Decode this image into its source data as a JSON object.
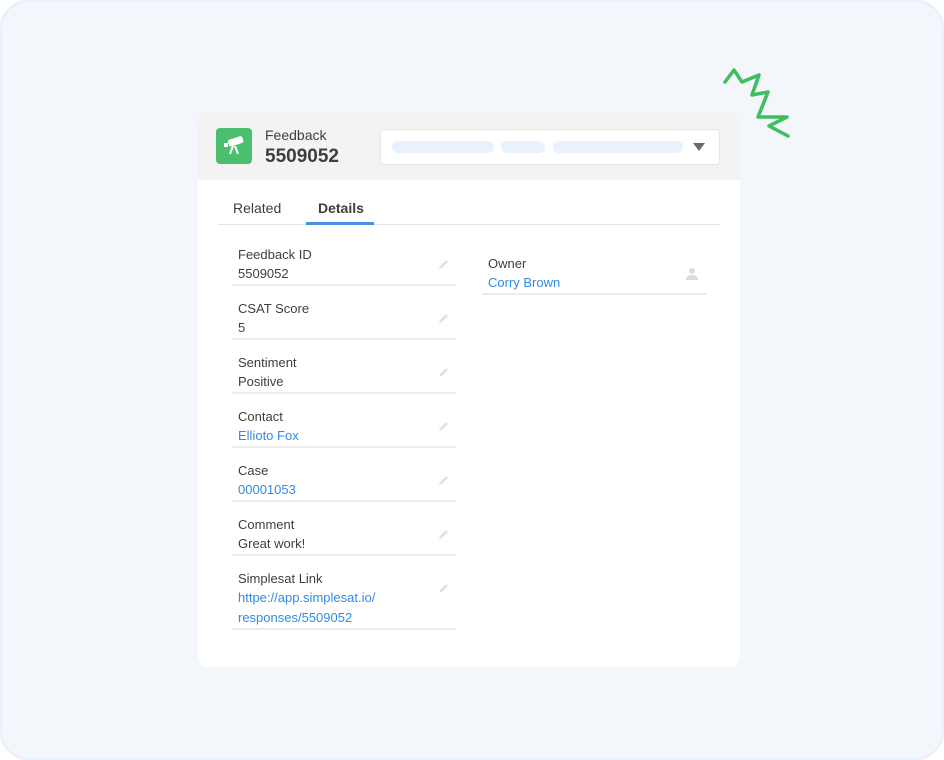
{
  "record": {
    "object_type": "Feedback",
    "name": "5509052",
    "icon": "telescope-icon",
    "icon_color": "#4cbf6e"
  },
  "path_selector": {
    "caret_icon": "caret-down-icon"
  },
  "tabs": [
    {
      "label": "Related",
      "active": false
    },
    {
      "label": "Details",
      "active": true
    }
  ],
  "accent_color": "#4a8fe7",
  "link_color": "#2f8be6",
  "details": {
    "left_fields": [
      {
        "label": "Feedback ID",
        "value": "5509052",
        "is_link": false
      },
      {
        "label": "CSAT Score",
        "value": "5",
        "is_link": false
      },
      {
        "label": "Sentiment",
        "value": "Positive",
        "is_link": false
      },
      {
        "label": "Contact",
        "value": "Ellioto Fox",
        "is_link": true
      },
      {
        "label": "Case",
        "value": "00001053",
        "is_link": true
      },
      {
        "label": "Comment",
        "value": "Great work!",
        "is_link": false
      },
      {
        "label": "Simplesat Link",
        "value_line1": "httpe://app.simplesat.io/",
        "value_line2": "responses/5509052",
        "is_link": true
      }
    ],
    "right_fields": [
      {
        "label": "Owner",
        "value": "Corry Brown",
        "is_link": true,
        "icon": "user-icon"
      }
    ]
  },
  "decoration": {
    "squiggle_color": "#3fbe5f"
  }
}
